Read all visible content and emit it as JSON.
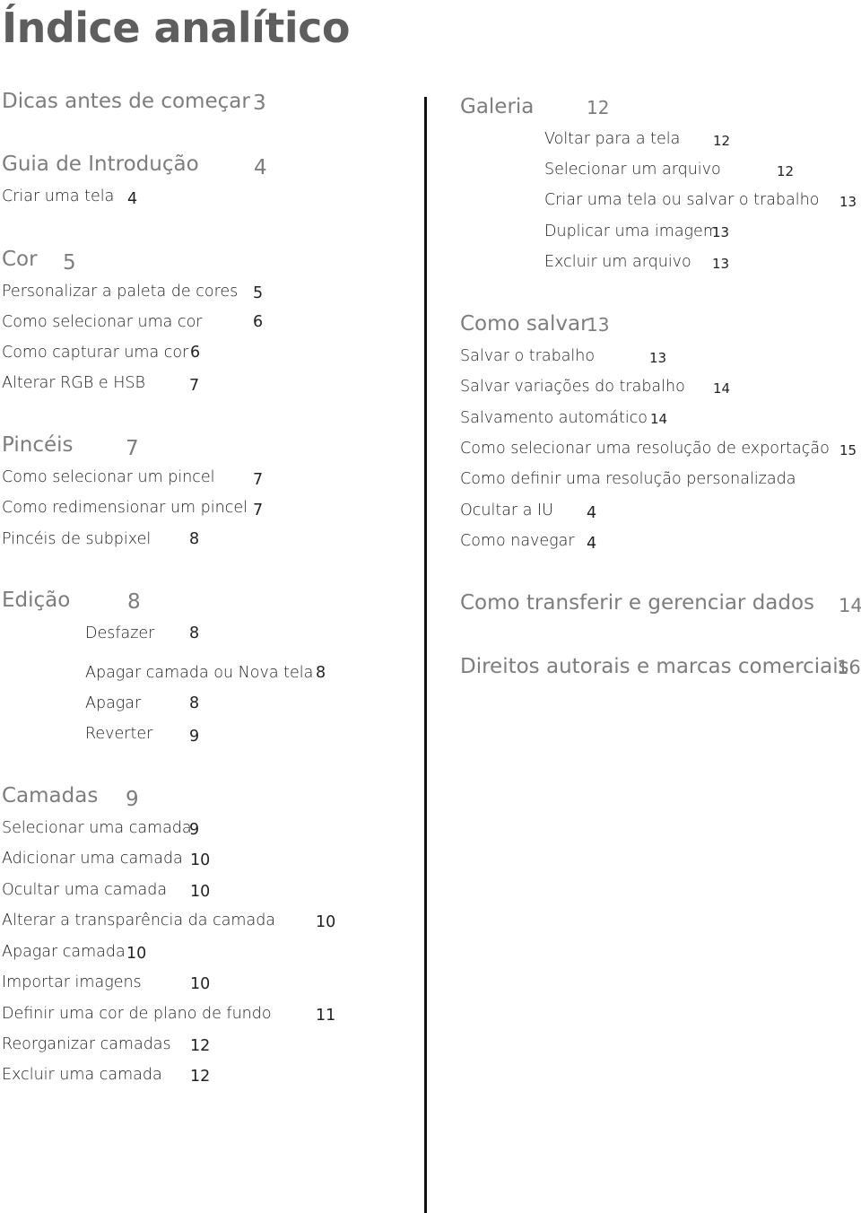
{
  "title": "Índice analítico",
  "left": {
    "dicas": {
      "title": "Dicas antes de começar",
      "page": "3"
    },
    "guia": {
      "title": "Guia de Introdução",
      "page": "4",
      "items": [
        {
          "label": "Criar uma tela",
          "page": "4"
        }
      ]
    },
    "cor": {
      "title": "Cor",
      "page": "5",
      "items": [
        {
          "label": "Personalizar a paleta de cores",
          "page": "5"
        },
        {
          "label": "Como selecionar uma cor",
          "page": "6"
        },
        {
          "label": "Como capturar uma cor",
          "page": "6"
        },
        {
          "label": "Alterar RGB e HSB",
          "page": "7"
        }
      ]
    },
    "pinceis": {
      "title": "Pincéis",
      "page": "7",
      "items": [
        {
          "label": "Como selecionar um pincel",
          "page": "7"
        },
        {
          "label": "Como redimensionar um pincel",
          "page": "7"
        },
        {
          "label": "Pincéis de subpixel",
          "page": "8"
        }
      ]
    },
    "edicao": {
      "title": "Edição",
      "page": "8",
      "items": [
        {
          "label": "Desfazer",
          "page": "8"
        },
        {
          "label": "Apagar camada ou Nova tela",
          "page": "8"
        },
        {
          "label": "Apagar",
          "page": "8"
        },
        {
          "label": "Reverter",
          "page": "9"
        }
      ]
    },
    "camadas": {
      "title": "Camadas",
      "page": "9",
      "items": [
        {
          "label": "Selecionar uma camada",
          "page": "9"
        },
        {
          "label": "Adicionar uma camada",
          "page": "10"
        },
        {
          "label": "Ocultar uma camada",
          "page": "10"
        },
        {
          "label": "Alterar a transparência da camada",
          "page": "10"
        },
        {
          "label": "Apagar camada",
          "page": "10"
        },
        {
          "label": "Importar imagens",
          "page": "10"
        },
        {
          "label": "Definir uma cor de plano de fundo",
          "page": "11"
        },
        {
          "label": "Reorganizar camadas",
          "page": "12"
        },
        {
          "label": "Excluir uma camada",
          "page": "12"
        }
      ]
    }
  },
  "right": {
    "galeria": {
      "title": "Galeria",
      "page": "12",
      "items": [
        {
          "label": "Voltar para a tela",
          "page": "12"
        },
        {
          "label": "Selecionar um arquivo",
          "page": "12"
        },
        {
          "label": "Criar uma tela ou salvar o trabalho",
          "page": "13"
        },
        {
          "label": "Duplicar uma imagem",
          "page": "13"
        },
        {
          "label": "Excluir um arquivo",
          "page": "13"
        }
      ]
    },
    "salvar": {
      "title": "Como salvar",
      "page": "13",
      "items": [
        {
          "label": "Salvar o trabalho",
          "page": "13"
        },
        {
          "label": "Salvar variações do trabalho",
          "page": "14"
        },
        {
          "label": "Salvamento automático",
          "page": "14"
        },
        {
          "label": "Como selecionar uma resolução de exportação",
          "page": "15"
        },
        {
          "label": "Como definir uma resolução personalizada",
          "page": ""
        },
        {
          "label": "Ocultar a IU",
          "page": "4"
        },
        {
          "label": "Como navegar",
          "page": "4"
        }
      ]
    },
    "transferir": {
      "title": "Como transferir e gerenciar dados",
      "page": "14"
    },
    "direitos": {
      "title": "Direitos autorais e marcas comerciais",
      "page": "16"
    }
  }
}
